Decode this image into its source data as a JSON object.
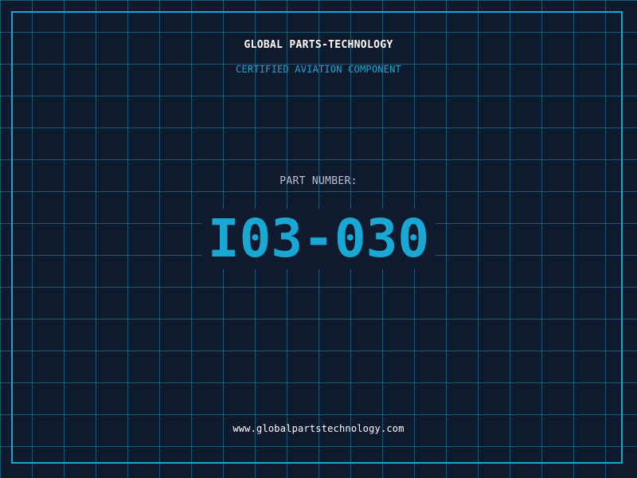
{
  "header": {
    "company": "GLOBAL PARTS-TECHNOLOGY",
    "subtitle": "CERTIFIED AVIATION COMPONENT"
  },
  "part": {
    "label": "PART NUMBER:",
    "number": "I03-030"
  },
  "footer": {
    "website": "www.globalpartstechnology.com"
  },
  "colors": {
    "background": "#0f1a2e",
    "accent": "#19a7d4",
    "grid": "#2a8caa",
    "text": "#ffffff",
    "label": "#b8c2d0"
  }
}
